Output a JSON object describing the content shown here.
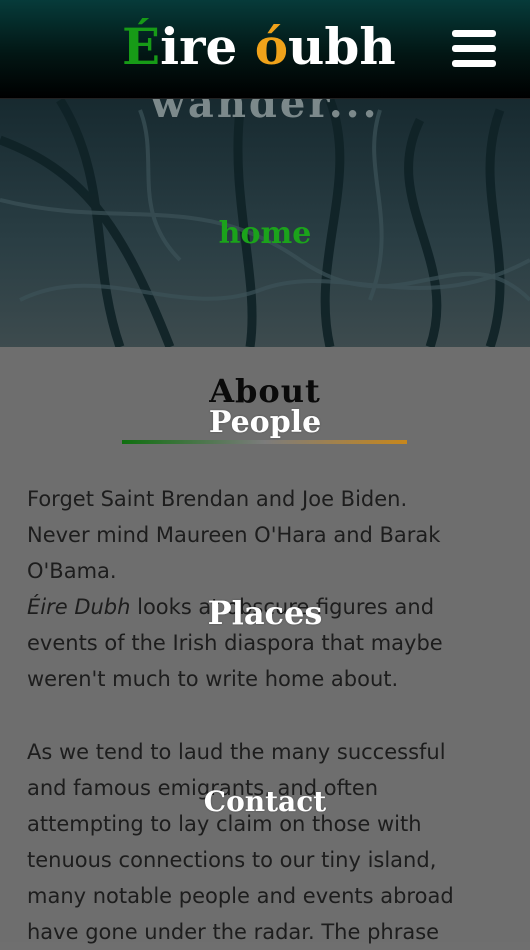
{
  "header": {
    "logo": {
      "part1": "É",
      "part2": "ire ",
      "part3": "ó",
      "part4": "ubh"
    },
    "menu_icon": "hamburger-menu-icon"
  },
  "hero": {
    "title": "wander...",
    "home_link": "home"
  },
  "about": {
    "heading": "About",
    "p1_line1": "Forget Saint Brendan and Joe Biden.",
    "p1_line2": "Never mind Maureen O'Hara and Barak",
    "p1_line3": "O'Bama.",
    "p2_em": "Éire Dubh",
    "p2_rest": " looks at obscure figures and",
    "p2_line2": "events of the Irish diaspora that maybe",
    "p2_line3": "weren't much to write home about.",
    "p3_line1": "As we tend to laud the many successful",
    "p3_line2": "and famous emigrants, and often",
    "p3_line3": "attempting to lay claim on those with",
    "p3_line4": "tenuous connections to our tiny island,",
    "p3_line5": "many notable people and events abroad",
    "p3_line6": "have gone under the radar. The phrase"
  },
  "nav": {
    "people": "People",
    "places": "Places",
    "contact": "Contact"
  },
  "colors": {
    "green": "#179b17",
    "orange": "#f0a21a",
    "overlay_grey": "#6e6e6e"
  }
}
